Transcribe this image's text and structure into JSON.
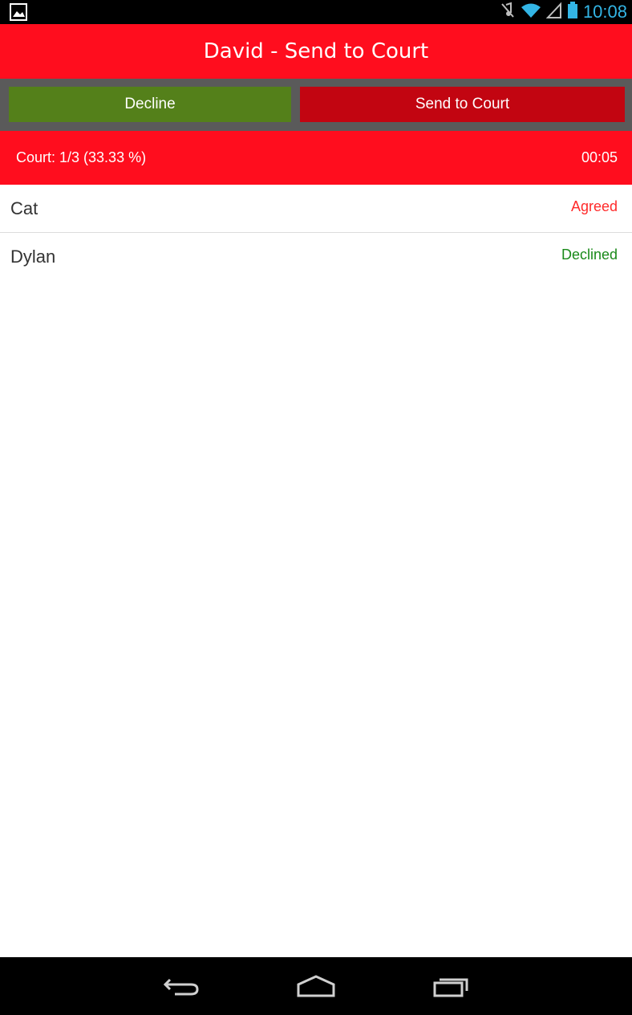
{
  "status_bar": {
    "time": "10:08",
    "icons": [
      "image-icon",
      "mute-icon",
      "wifi-icon",
      "signal-icon",
      "battery-icon"
    ]
  },
  "title_bar": {
    "title": "David - Send to Court"
  },
  "actions": {
    "decline_label": "Decline",
    "send_label": "Send to Court"
  },
  "progress": {
    "label": "Court: 1/3 (33.33 %)",
    "timer": "00:05"
  },
  "voters": [
    {
      "name": "Cat",
      "status": "Agreed",
      "status_color": "#ff2a2a"
    },
    {
      "name": "Dylan",
      "status": "Declined",
      "status_color": "#1a8a1a"
    }
  ],
  "colors": {
    "primary_red": "#ff0d1e",
    "decline_green": "#54801a",
    "send_dark_red": "#c20511",
    "status_blue": "#33b5e5"
  },
  "nav_bar": {
    "icons": [
      "back-icon",
      "home-icon",
      "recent-apps-icon"
    ]
  }
}
